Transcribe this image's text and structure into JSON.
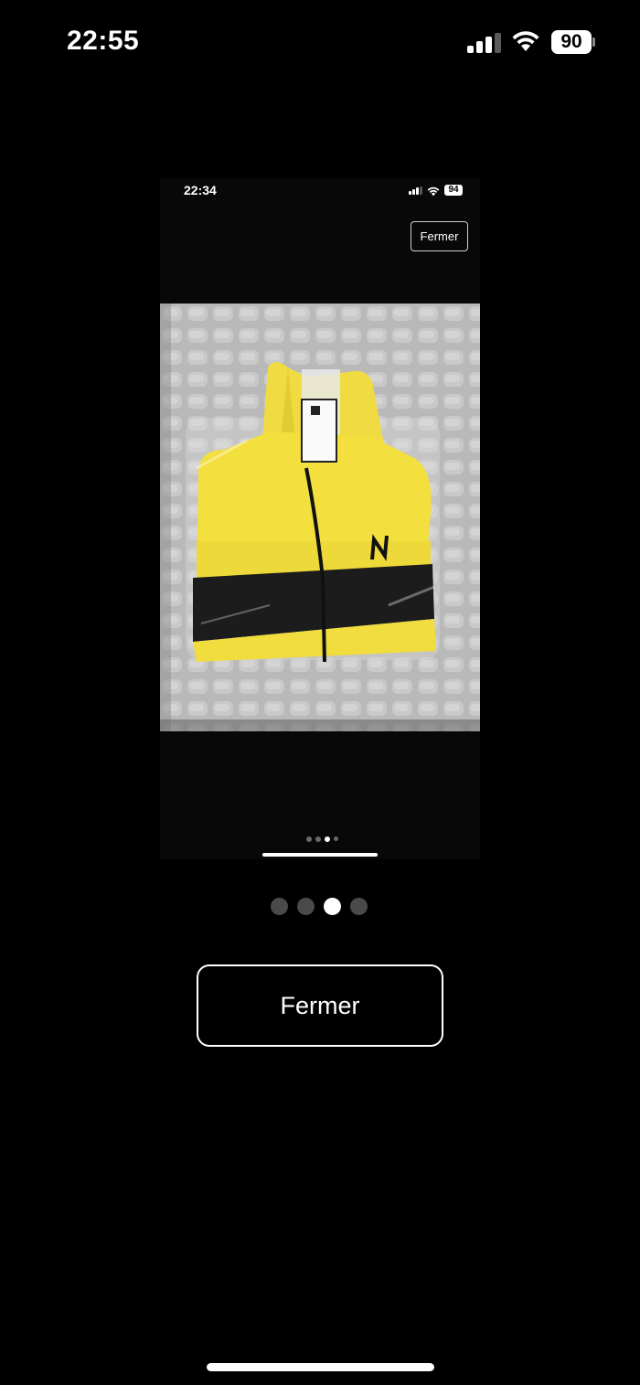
{
  "status_bar": {
    "time": "22:55",
    "battery_level": "90",
    "signal_bars": 3,
    "wifi": true
  },
  "inner_screenshot": {
    "status_bar": {
      "time": "22:34",
      "battery_level": "94"
    },
    "close_button_label": "Fermer",
    "photo": {
      "subject": "yellow and black jacket with NJ logo in plastic bag on grey bedspread",
      "colors": {
        "jacket": "#f3df3e",
        "band": "#1c1c1c",
        "bedspread": "#b7b7b7"
      }
    },
    "page_indicator": {
      "count": 4,
      "active_index": 2
    }
  },
  "carousel": {
    "count": 4,
    "active_index": 2,
    "active_color": "#ffffff",
    "inactive_color": "#4a4a4a"
  },
  "close_button_label": "Fermer"
}
